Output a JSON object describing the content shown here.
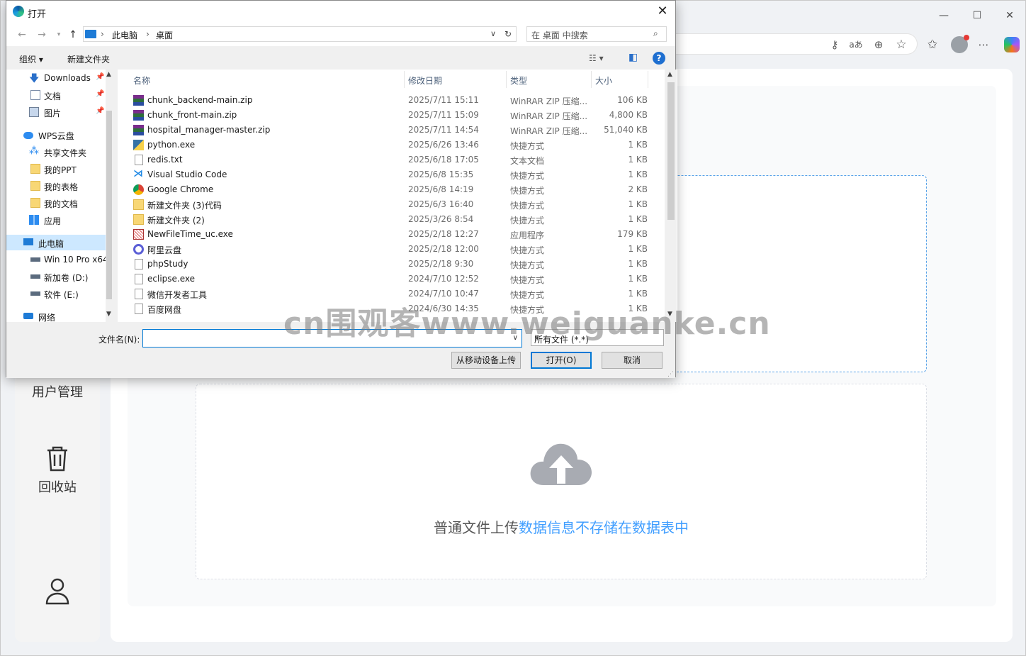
{
  "browser": {
    "window_controls": {
      "minimize": "—",
      "maximize": "☐",
      "close": "✕"
    },
    "toolbar_icons": [
      "key-icon",
      "read-aloud-icon",
      "zoom-icon",
      "favorite-star-icon",
      "favorites-icon",
      "profile-avatar",
      "more-icon",
      "copilot-icon"
    ]
  },
  "app": {
    "sidebar": {
      "user_mgmt": "用户管理",
      "recycle_bin": "回收站"
    },
    "upload": {
      "prefix": "普通文件上传",
      "highlight": "数据信息不存储在数据表中"
    },
    "colors": {
      "accent": "#409eff",
      "cloud": "#a8abb2"
    }
  },
  "dialog": {
    "title": "打开",
    "path": {
      "root": "此电脑",
      "current": "桌面"
    },
    "search_placeholder": "在 桌面 中搜索",
    "toolbar": {
      "organize": "组织 ▾",
      "new_folder": "新建文件夹"
    },
    "nav": [
      {
        "label": "Downloads",
        "icon": "download-arrow-icon",
        "pinned": true
      },
      {
        "label": "文档",
        "icon": "document-icon",
        "pinned": true
      },
      {
        "label": "图片",
        "icon": "picture-icon",
        "pinned": true
      },
      {
        "label": "WPS云盘",
        "icon": "wps-cloud-icon"
      },
      {
        "label": "共享文件夹",
        "icon": "shared-folder-icon"
      },
      {
        "label": "我的PPT",
        "icon": "folder-icon"
      },
      {
        "label": "我的表格",
        "icon": "folder-icon"
      },
      {
        "label": "我的文档",
        "icon": "folder-icon"
      },
      {
        "label": "应用",
        "icon": "apps-icon"
      },
      {
        "label": "此电脑",
        "icon": "pc-icon"
      },
      {
        "label": "Win 10 Pro x64",
        "icon": "drive-icon"
      },
      {
        "label": "新加卷 (D:)",
        "icon": "drive-icon"
      },
      {
        "label": "软件 (E:)",
        "icon": "drive-icon"
      },
      {
        "label": "网络",
        "icon": "network-icon"
      }
    ],
    "columns": {
      "name": "名称",
      "date": "修改日期",
      "type": "类型",
      "size": "大小"
    },
    "files": [
      {
        "name": "chunk_backend-main.zip",
        "date": "2025/7/11 15:11",
        "type": "WinRAR ZIP 压缩...",
        "size": "106 KB",
        "icon": "winrar-icon"
      },
      {
        "name": "chunk_front-main.zip",
        "date": "2025/7/11 15:09",
        "type": "WinRAR ZIP 压缩...",
        "size": "4,800 KB",
        "icon": "winrar-icon"
      },
      {
        "name": "hospital_manager-master.zip",
        "date": "2025/7/11 14:54",
        "type": "WinRAR ZIP 压缩...",
        "size": "51,040 KB",
        "icon": "winrar-icon"
      },
      {
        "name": "python.exe",
        "date": "2025/6/26 13:46",
        "type": "快捷方式",
        "size": "1 KB",
        "icon": "python-icon"
      },
      {
        "name": "redis.txt",
        "date": "2025/6/18 17:05",
        "type": "文本文档",
        "size": "1 KB",
        "icon": "text-file-icon"
      },
      {
        "name": "Visual Studio Code",
        "date": "2025/6/8 15:35",
        "type": "快捷方式",
        "size": "1 KB",
        "icon": "vscode-icon"
      },
      {
        "name": "Google Chrome",
        "date": "2025/6/8 14:19",
        "type": "快捷方式",
        "size": "2 KB",
        "icon": "chrome-icon"
      },
      {
        "name": "新建文件夹 (3)代码",
        "date": "2025/6/3 16:40",
        "type": "快捷方式",
        "size": "1 KB",
        "icon": "folder-icon"
      },
      {
        "name": "新建文件夹 (2)",
        "date": "2025/3/26 8:54",
        "type": "快捷方式",
        "size": "1 KB",
        "icon": "folder-icon"
      },
      {
        "name": "NewFileTime_uc.exe",
        "date": "2025/2/18 12:27",
        "type": "应用程序",
        "size": "179 KB",
        "icon": "exe-icon"
      },
      {
        "name": "阿里云盘",
        "date": "2025/2/18 12:00",
        "type": "快捷方式",
        "size": "1 KB",
        "icon": "aliyun-icon"
      },
      {
        "name": "phpStudy",
        "date": "2025/2/18 9:30",
        "type": "快捷方式",
        "size": "1 KB",
        "icon": "blank-file-icon"
      },
      {
        "name": "eclipse.exe",
        "date": "2024/7/10 12:52",
        "type": "快捷方式",
        "size": "1 KB",
        "icon": "blank-file-icon"
      },
      {
        "name": "微信开发者工具",
        "date": "2024/7/10 10:47",
        "type": "快捷方式",
        "size": "1 KB",
        "icon": "blank-file-icon"
      },
      {
        "name": "百度网盘",
        "date": "2024/6/30 14:35",
        "type": "快捷方式",
        "size": "1 KB",
        "icon": "blank-file-icon"
      }
    ],
    "filename_label": "文件名(N):",
    "filename_value": "",
    "filetype": "所有文件 (*.*)",
    "buttons": {
      "mobile": "从移动设备上传",
      "open": "打开(O)",
      "cancel": "取消"
    }
  },
  "watermark": "cn围观客www.weiguanke.cn"
}
